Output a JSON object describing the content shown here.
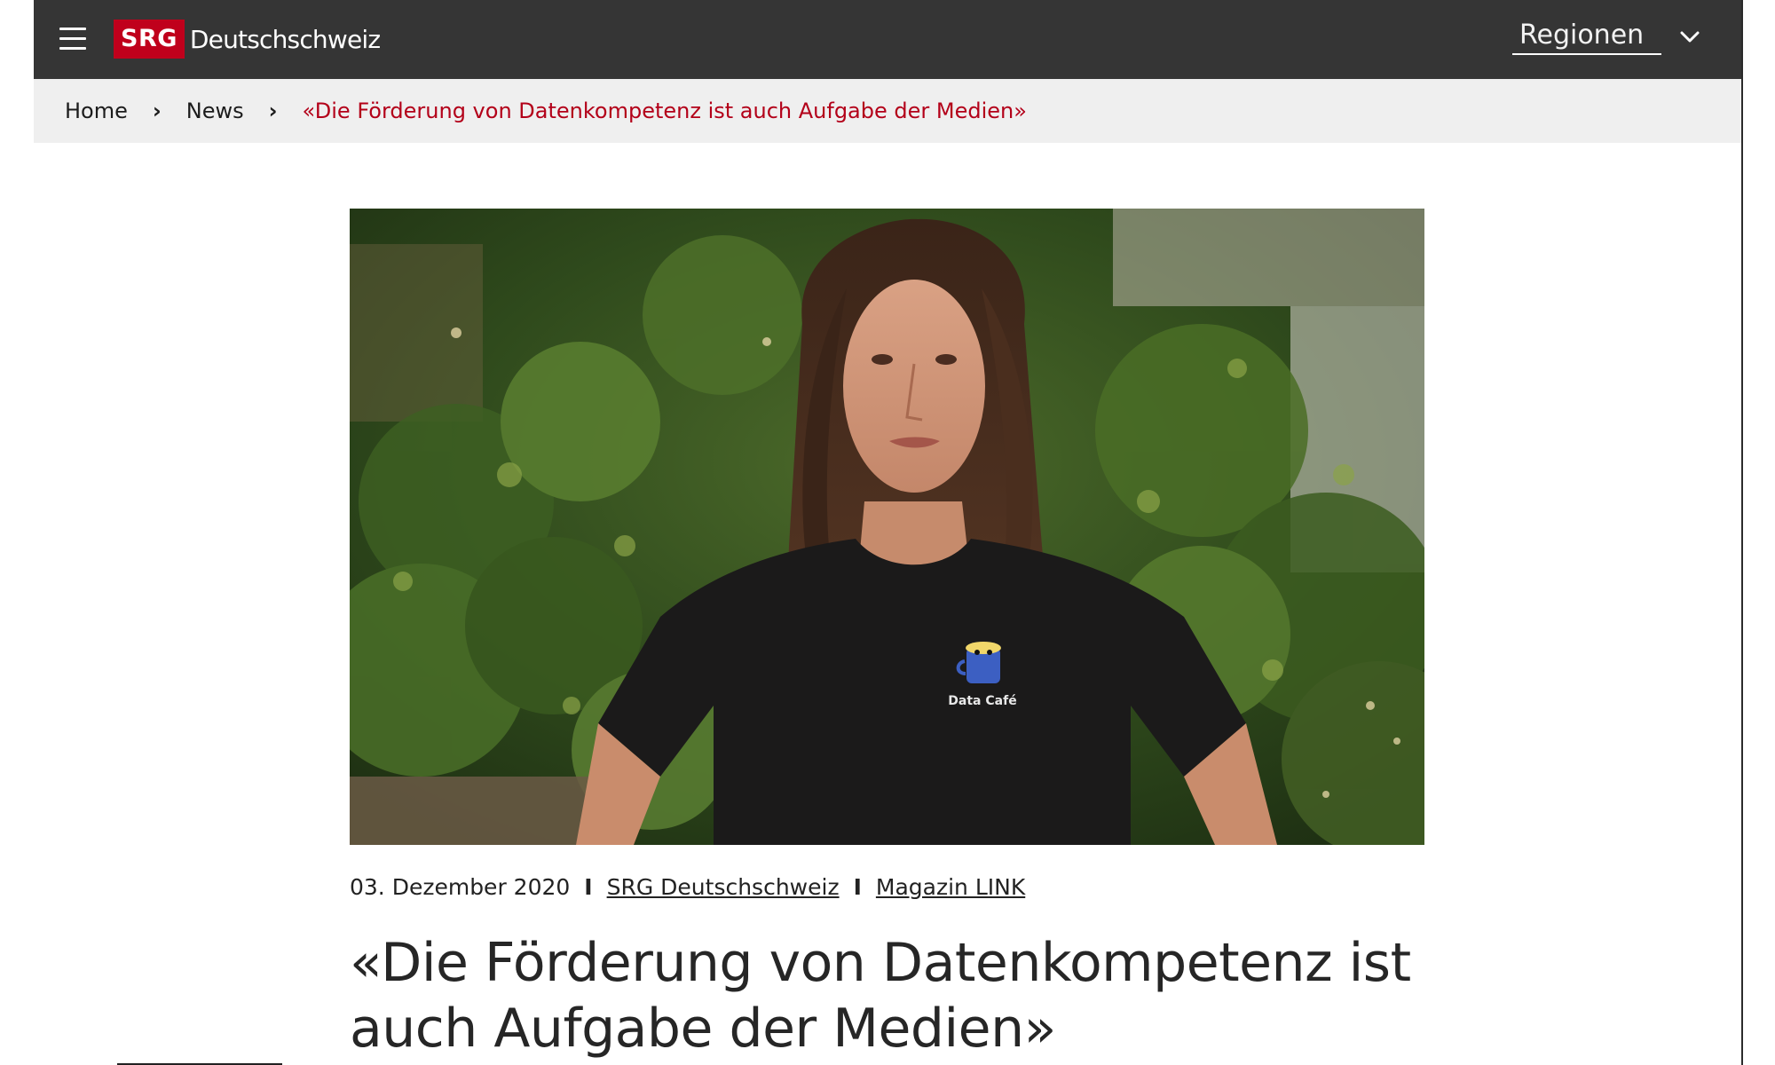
{
  "header": {
    "logo_badge": "SRG",
    "logo_text": "Deutschschweiz",
    "regions_label": "Regionen",
    "background_color": "#353535",
    "brand_color": "#c0001c"
  },
  "breadcrumb": {
    "items": [
      {
        "label": "Home"
      },
      {
        "label": "News"
      },
      {
        "label": "«Die Förderung von Datenkompetenz ist auch Aufgabe der Medien»"
      }
    ],
    "separator": "›",
    "current_color": "#b30019"
  },
  "hero": {
    "shirt_print": "Data Café"
  },
  "article": {
    "date": "03. Dezember 2020",
    "meta_separator": "I",
    "author_link": "SRG Deutschschweiz",
    "section_link": "Magazin LINK",
    "title": "«Die Förderung von Datenkompetenz ist auch Aufgabe der Medien»"
  },
  "icons": {
    "menu": "hamburger-menu-icon",
    "dropdown": "chevron-down-icon"
  }
}
